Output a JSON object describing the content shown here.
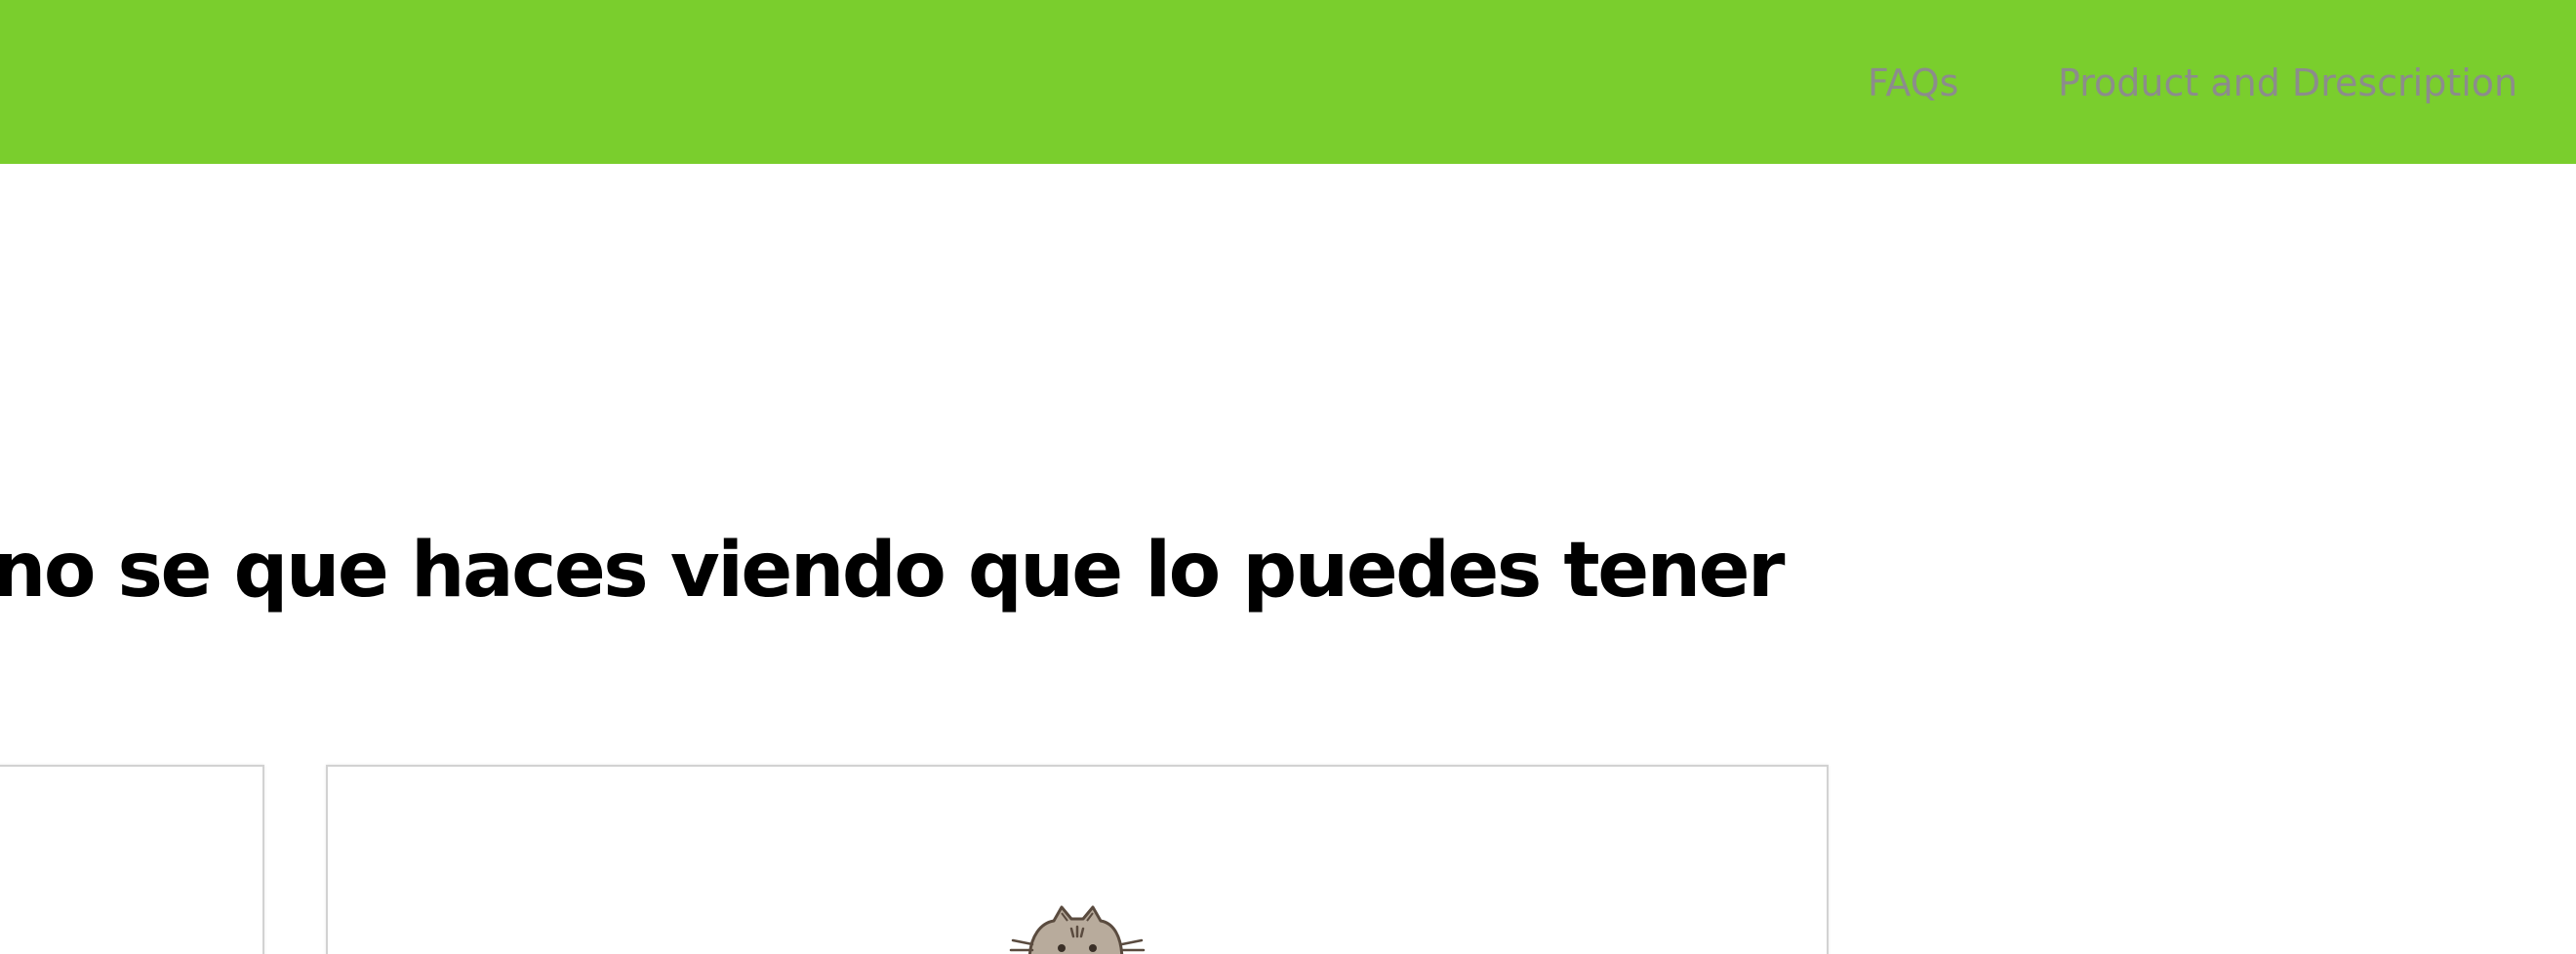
{
  "nav": {
    "links": [
      {
        "label": "FAQs"
      },
      {
        "label": "Product and Drescription"
      }
    ]
  },
  "hero": {
    "headline": "eible, no se que haces viendo que lo puedes tener"
  },
  "colors": {
    "header_bg": "#7ace2d",
    "nav_text": "#8c8c8c",
    "headline_text": "#000000",
    "card_border": "#d2d2d2"
  },
  "icons": {
    "card_image": "cat-icon"
  }
}
